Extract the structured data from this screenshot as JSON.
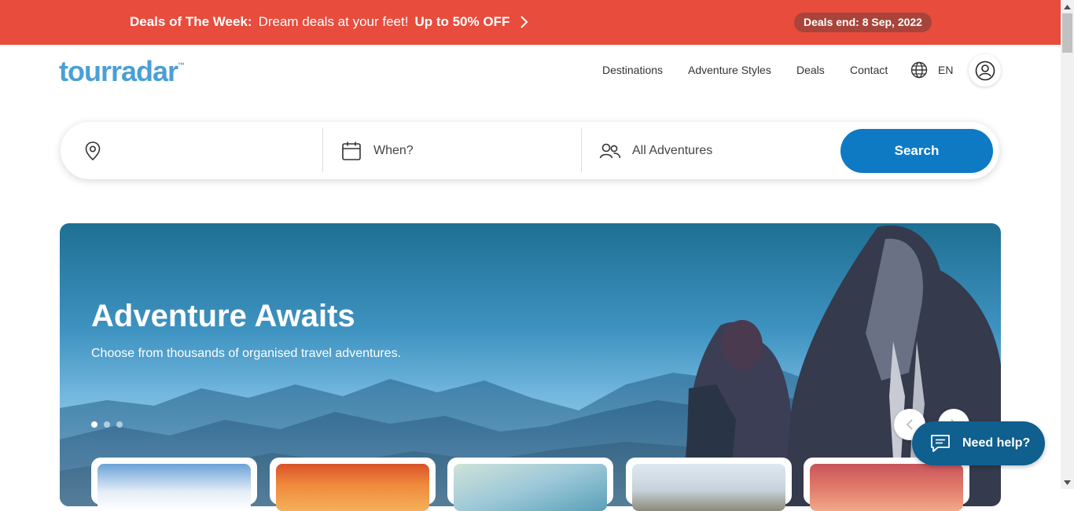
{
  "deals_banner": {
    "title": "Deals of The Week:",
    "message": "Dream deals at your feet!",
    "offer": "Up to 50% OFF",
    "deadline": "Deals end: 8 Sep, 2022",
    "color": "#e84c3d"
  },
  "header": {
    "logo": "tourradar",
    "logo_tm": "™",
    "nav": [
      "Destinations",
      "Adventure Styles",
      "Deals",
      "Contact"
    ],
    "language": "EN"
  },
  "search": {
    "destination_placeholder": "",
    "when_label": "When?",
    "adventure_label": "All Adventures",
    "button_label": "Search",
    "button_color": "#0e7ac4"
  },
  "hero": {
    "title": "Adventure Awaits",
    "subtitle": "Choose from thousands of organised travel adventures.",
    "slide_count": 3,
    "active_slide": 1
  },
  "help": {
    "label": "Need help?"
  }
}
